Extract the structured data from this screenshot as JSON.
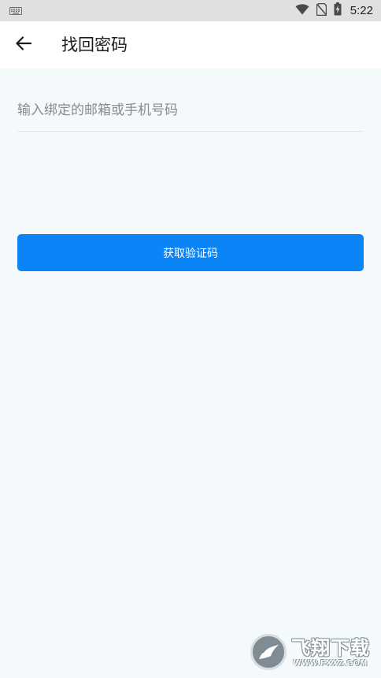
{
  "status_bar": {
    "time": "5:22",
    "icons": [
      "keyboard-icon",
      "wifi-icon",
      "no-sim-icon",
      "battery-charging-icon"
    ]
  },
  "app_bar": {
    "title": "找回密码",
    "back_icon": "arrow-left-icon"
  },
  "form": {
    "account_placeholder": "输入绑定的邮箱或手机号码",
    "account_value": "",
    "submit_label": "获取验证码"
  },
  "watermark": {
    "brand": "飞翔下载",
    "url": "WWW.FXXZ.COM"
  },
  "colors": {
    "accent": "#0a84f7",
    "page_bg": "#f4f9fc",
    "app_bar_bg": "#ffffff",
    "status_bar_bg": "#e0e0e0"
  }
}
